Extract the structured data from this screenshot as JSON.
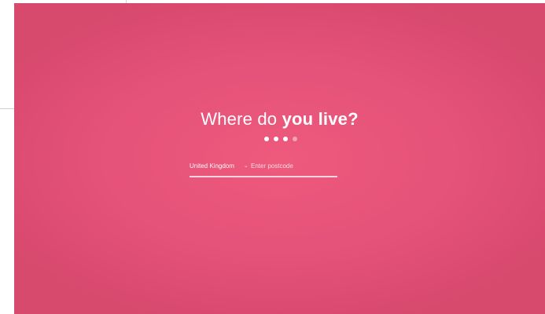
{
  "heading": {
    "prefix": "Where do ",
    "emphasis": "you live?"
  },
  "steps": {
    "total": 4,
    "current": 3
  },
  "form": {
    "country_value": "United Kingdom",
    "country_chevron": "⌄",
    "postcode_placeholder": "Enter postcode",
    "postcode_value": ""
  },
  "colors": {
    "background": "#e5527a",
    "text": "#ffffff"
  }
}
